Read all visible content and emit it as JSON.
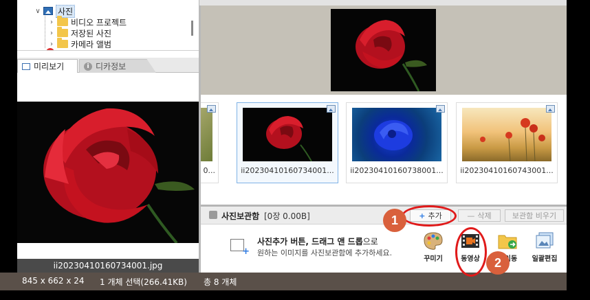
{
  "tree": {
    "items": [
      {
        "label": "사진",
        "expanded": true
      },
      {
        "label": "비디오 프로젝트"
      },
      {
        "label": "저장된 사진"
      },
      {
        "label": "카메라 앨범"
      }
    ]
  },
  "preview_tabs": [
    {
      "label": "미리보기",
      "active": true
    },
    {
      "label": "디카정보",
      "active": false
    }
  ],
  "preview": {
    "filename": "ii20230410160734001.jpg"
  },
  "thumbnails": [
    {
      "caption": "ii20230410160734001...",
      "selected": true
    },
    {
      "caption": "ii20230410160738001...",
      "selected": false
    },
    {
      "caption": "ii20230410160743001...",
      "selected": false
    }
  ],
  "partial_thumb": {
    "caption": "0..."
  },
  "album": {
    "title": "사진보관함",
    "count": "[0장 0.00B]",
    "add_label": "추가",
    "delete_label": "삭제",
    "clear_label": "보관함 비우기"
  },
  "drop_hint": {
    "line1_bold": "사진추가 버튼, 드래그 앤 드롭",
    "line1_tail": "으로",
    "line2": "원하는 이미지를 사진보관함에 추가하세요."
  },
  "tools": [
    {
      "label": "꾸미기",
      "icon": "palette-icon"
    },
    {
      "label": "동영상",
      "icon": "video-icon"
    },
    {
      "label": "이동",
      "icon": "move-folder-icon"
    },
    {
      "label": "일괄편집",
      "icon": "batch-edit-icon"
    }
  ],
  "status": {
    "dimensions": "845 x 662 x 24",
    "selection": "1 개체 선택(266.41KB)",
    "total": "총 8 개체"
  },
  "annotations": {
    "step1": "1",
    "step2": "2",
    "color": "#e01a1a"
  }
}
